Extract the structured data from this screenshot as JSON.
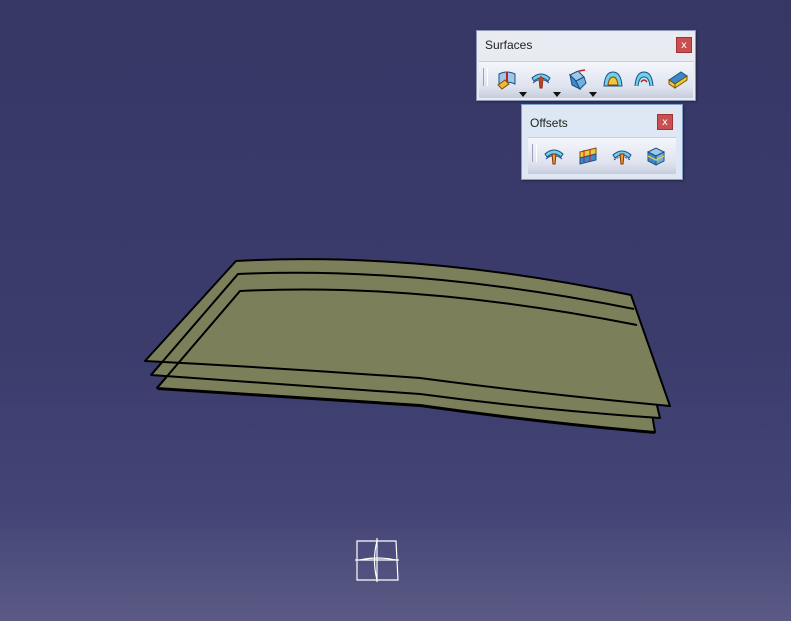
{
  "toolbars": {
    "surfaces": {
      "title": "Surfaces",
      "close_label": "x",
      "buttons": [
        "extrude-surface-icon",
        "offset-surface-icon",
        "sweep-surface-icon",
        "fill-surface-icon",
        "multi-section-surface-icon",
        "blend-surface-icon"
      ]
    },
    "offsets": {
      "title": "Offsets",
      "close_label": "x",
      "buttons": [
        "offset-icon",
        "variable-offset-icon",
        "rough-offset-icon",
        "thick-surface-icon"
      ]
    }
  },
  "colors": {
    "background_top": "#373766",
    "background_bottom": "#5b5a85",
    "surface_fill": "#7b7f5a",
    "surface_edge": "#000000",
    "compass": "#ffffff"
  }
}
